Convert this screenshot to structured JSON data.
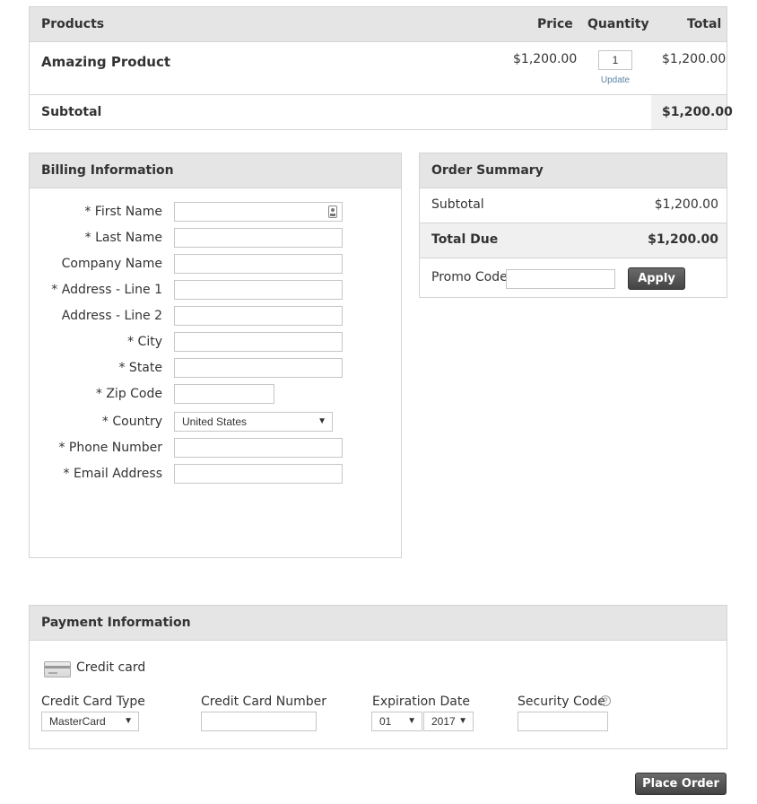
{
  "cart": {
    "headers": {
      "products": "Products",
      "price": "Price",
      "quantity": "Quantity",
      "total": "Total"
    },
    "item": {
      "name": "Amazing Product",
      "price": "$1,200.00",
      "quantity": "1",
      "update_label": "Update",
      "total": "$1,200.00"
    },
    "subtotal_label": "Subtotal",
    "subtotal_value": "$1,200.00"
  },
  "billing": {
    "title": "Billing Information",
    "fields": {
      "first_name": "* First Name",
      "last_name": "* Last Name",
      "company": "Company Name",
      "address1": "* Address - Line 1",
      "address2": "Address - Line 2",
      "city": "* City",
      "state": "* State",
      "zip": "* Zip Code",
      "country": "* Country",
      "phone": "* Phone Number",
      "email": "* Email Address"
    },
    "country_value": "United States"
  },
  "summary": {
    "title": "Order Summary",
    "subtotal_label": "Subtotal",
    "subtotal_value": "$1,200.00",
    "total_label": "Total Due",
    "total_value": "$1,200.00",
    "promo_label": "Promo Code:",
    "apply_label": "Apply"
  },
  "payment": {
    "title": "Payment Information",
    "method_label": "Credit card",
    "card_type_label": "Credit Card Type",
    "card_type_value": "MasterCard",
    "card_number_label": "Credit Card Number",
    "expiration_label": "Expiration Date",
    "exp_month": "01",
    "exp_year": "2017",
    "security_label": "Security Code",
    "help_glyph": "?"
  },
  "place_order_label": "Place Order",
  "icons": {
    "contact": "contact-card-icon",
    "card": "credit-card-icon",
    "help": "help-icon",
    "caret": "caret-down-icon"
  }
}
